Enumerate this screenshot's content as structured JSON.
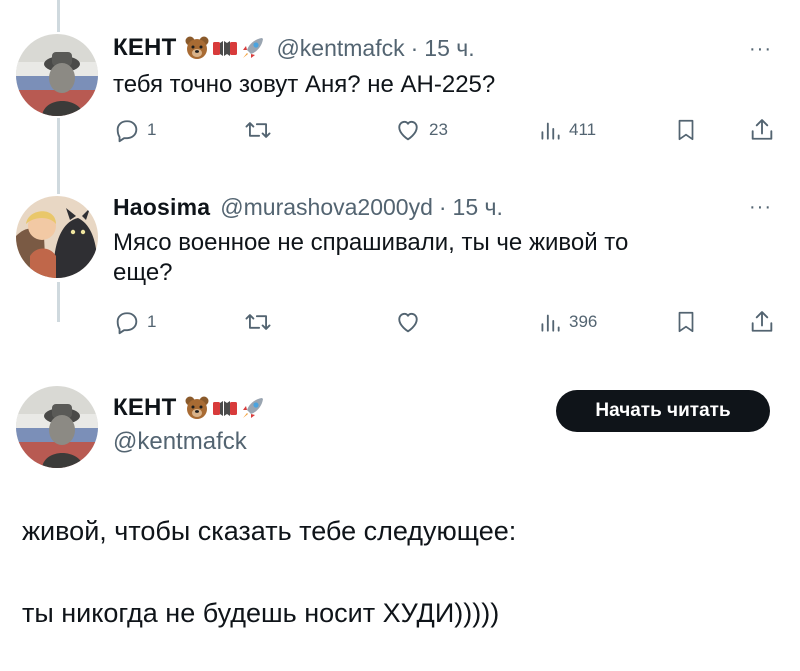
{
  "tweets": [
    {
      "name": "КЕНТ",
      "handle": "@kentmafck",
      "separator": "·",
      "time": "15 ч.",
      "text_lines": [
        "тебя точно зовут Аня? не АН-225?"
      ],
      "replies": "1",
      "retweets": "",
      "likes": "23",
      "views": "411",
      "emoji_names": [
        "bear-emoji",
        "accordion-emoji",
        "rocket-emoji"
      ]
    },
    {
      "name": "Haosima",
      "handle": "@murashova2000yd",
      "separator": "·",
      "time": "15 ч.",
      "text_lines": [
        "Мясо военное не спрашивали, ты че живой то",
        "еще?"
      ],
      "replies": "1",
      "retweets": "",
      "likes": "",
      "views": "396"
    }
  ],
  "more_label": "···",
  "main_tweet": {
    "name": "КЕНТ",
    "handle": "@kentmafck",
    "follow_label": "Начать читать",
    "text_lines": [
      "живой, чтобы сказать тебе следующее:",
      "ты никогда не будешь носит ХУДИ)))))"
    ]
  },
  "colors": {
    "text": "#0f1419",
    "secondary": "#536471",
    "thread_line": "#cfd9de",
    "button_bg": "#0f1419",
    "button_text": "#ffffff"
  }
}
